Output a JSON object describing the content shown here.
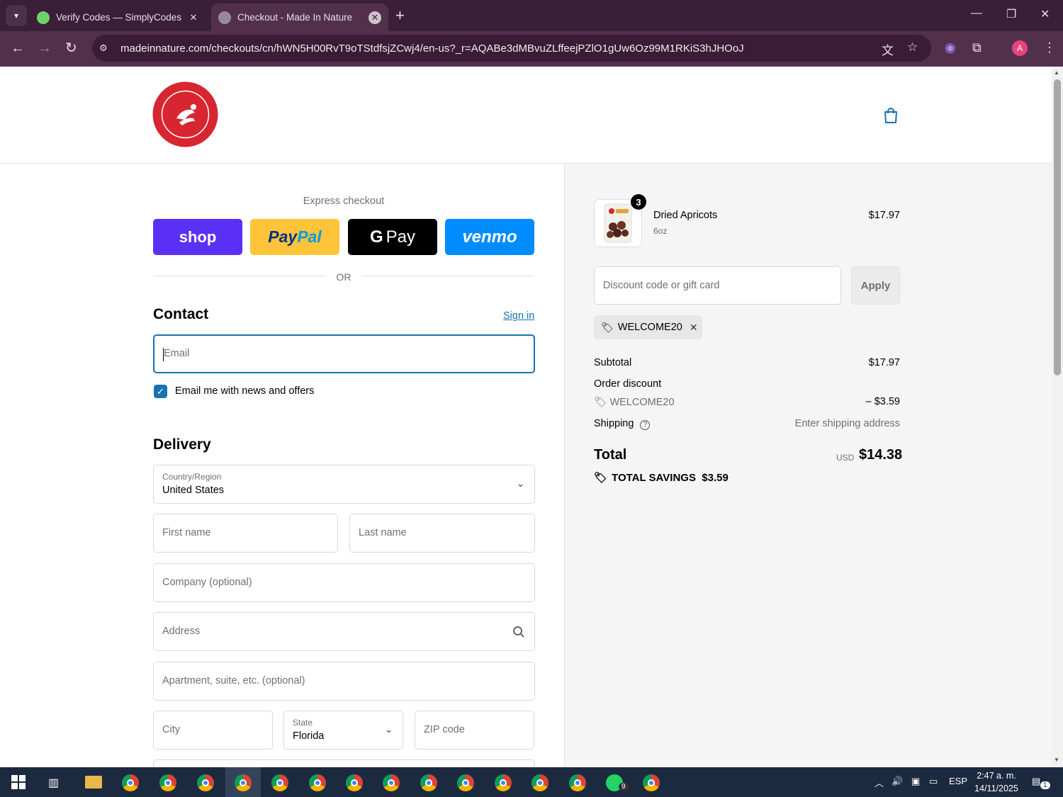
{
  "browser": {
    "tabs": [
      {
        "title": "Verify Codes — SimplyCodes",
        "active": false
      },
      {
        "title": "Checkout - Made In Nature",
        "active": true
      }
    ],
    "url": "madeinnature.com/checkouts/cn/hWN5H00RvT9oTStdfsjZCwj4/en-us?_r=AQABe3dMBvuZLffeejPZlO1gUw6Oz99M1RKiS3hJHOoJ",
    "profile_initial": "A"
  },
  "checkout": {
    "express_label": "Express checkout",
    "buttons": {
      "shop": "shop",
      "paypal_a": "Pay",
      "paypal_b": "Pal",
      "gpay_g": "G",
      "gpay": "Pay",
      "venmo": "venmo"
    },
    "or_label": "OR",
    "contact": {
      "heading": "Contact",
      "signin": "Sign in",
      "email_placeholder": "Email",
      "news_label": "Email me with news and offers",
      "news_checked": true
    },
    "delivery": {
      "heading": "Delivery",
      "country_label": "Country/Region",
      "country_value": "United States",
      "first_name": "First name",
      "last_name": "Last name",
      "company": "Company (optional)",
      "address": "Address",
      "apartment": "Apartment, suite, etc. (optional)",
      "city": "City",
      "state_label": "State",
      "state_value": "Florida",
      "zip": "ZIP code"
    }
  },
  "summary": {
    "product": {
      "name": "Dried Apricots",
      "variant": "6oz",
      "price": "$17.97",
      "quantity": "3"
    },
    "discount_placeholder": "Discount code or gift card",
    "apply": "Apply",
    "applied_code": "WELCOME20",
    "subtotal_label": "Subtotal",
    "subtotal": "$17.97",
    "order_discount_label": "Order discount",
    "discount_code": "WELCOME20",
    "discount_amount": "– $3.59",
    "shipping_label": "Shipping",
    "shipping_value": "Enter shipping address",
    "total_label": "Total",
    "currency": "USD",
    "total": "$14.38",
    "savings": "TOTAL SAVINGS  $3.59"
  },
  "taskbar": {
    "language": "ESP",
    "time": "2:47 a. m.",
    "date": "14/11/2025",
    "whatsapp_badge": "9",
    "notifications": "1"
  },
  "colors": {
    "accent": "#1773b0",
    "shop": "#5a31f4",
    "paypal": "#ffc439",
    "venmo": "#008cff",
    "brand_red": "#d7262f"
  }
}
